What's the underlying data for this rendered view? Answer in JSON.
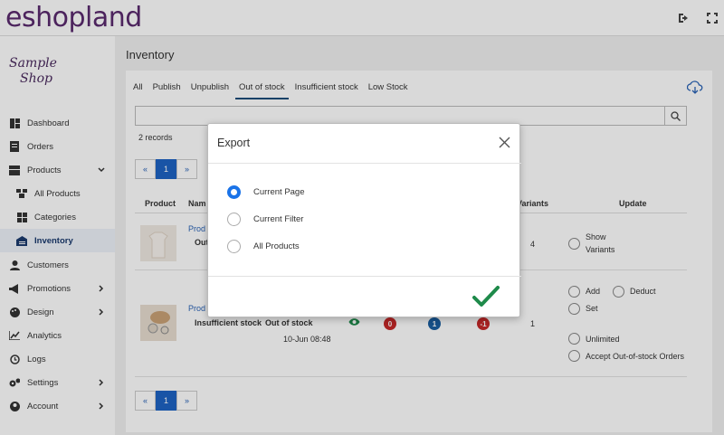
{
  "topbar": {
    "logo": "eshopland",
    "icons": [
      "logout-icon",
      "fullscreen-icon"
    ]
  },
  "sidebar": {
    "shop_logo_line1": "Sample",
    "shop_logo_line2": "Shop",
    "items": [
      {
        "label": "Dashboard",
        "icon": "dashboard-icon"
      },
      {
        "label": "Orders",
        "icon": "orders-icon"
      },
      {
        "label": "Products",
        "icon": "products-icon",
        "expanded": true
      },
      {
        "label": "All Products",
        "icon": "all-products-icon"
      },
      {
        "label": "Categories",
        "icon": "categories-icon"
      },
      {
        "label": "Inventory",
        "icon": "inventory-icon",
        "active": true
      },
      {
        "label": "Customers",
        "icon": "customers-icon"
      },
      {
        "label": "Promotions",
        "icon": "promotions-icon"
      },
      {
        "label": "Design",
        "icon": "design-icon"
      },
      {
        "label": "Analytics",
        "icon": "analytics-icon"
      },
      {
        "label": "Logs",
        "icon": "logs-icon"
      },
      {
        "label": "Settings",
        "icon": "settings-icon"
      },
      {
        "label": "Account",
        "icon": "account-icon"
      }
    ]
  },
  "main": {
    "title": "Inventory",
    "tabs": [
      "All",
      "Publish",
      "Unpublish",
      "Out of stock",
      "Insufficient stock",
      "Low Stock"
    ],
    "active_tab": "Out of stock",
    "records": "2 records",
    "pager": {
      "prev": "«",
      "page": "1",
      "next": "»"
    },
    "columns": {
      "product": "Product",
      "name": "Nam",
      "variants": "Variants",
      "update": "Update"
    },
    "rows": [
      {
        "name": "Prod",
        "status1": "Out",
        "variants": "4",
        "update_option1": "Show",
        "update_option2": "Variants"
      },
      {
        "name": "Prod",
        "status1": "Insufficient stock",
        "status2": "Out of stock",
        "date": "10-Jun 08:48",
        "badge1": "0",
        "badge2": "1",
        "badge3": "-1",
        "variants": "1",
        "update_add": "Add",
        "update_deduct": "Deduct",
        "update_set": "Set",
        "update_unlimited": "Unlimited",
        "update_accept": "Accept Out-of-stock Orders"
      }
    ]
  },
  "modal": {
    "title": "Export",
    "options": [
      "Current Page",
      "Current Filter",
      "All Products"
    ],
    "selected": "Current Page"
  },
  "colors": {
    "brand": "#5a2a6e",
    "accent": "#1a73e8",
    "danger": "#b71c1c",
    "confirm": "#1e8a4a"
  }
}
